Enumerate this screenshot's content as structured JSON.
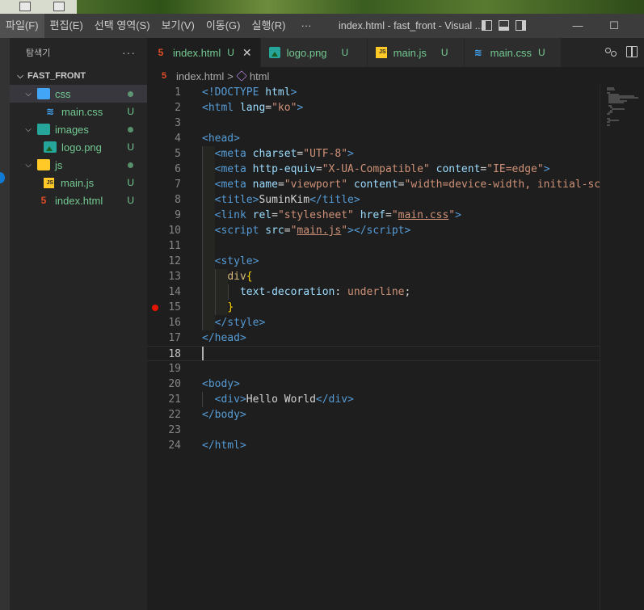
{
  "menubar": {
    "items": [
      "파일(F)",
      "편집(E)",
      "선택 영역(S)",
      "보기(V)",
      "이동(G)",
      "실행(R)",
      "···"
    ],
    "window_title": "index.html - fast_front - Visual ...",
    "restore_glyph": "☐",
    "minimize_glyph": "—"
  },
  "sidebar": {
    "title": "탐색기",
    "more": "···",
    "project": "FAST_FRONT",
    "tree": [
      {
        "label": "css",
        "type": "folder",
        "icon": "folder-css-icon",
        "status": "dot",
        "depth": 0
      },
      {
        "label": "main.css",
        "type": "css",
        "icon": "css-file-icon",
        "status": "U",
        "depth": 1
      },
      {
        "label": "images",
        "type": "folder",
        "icon": "folder-images-icon",
        "status": "dot",
        "depth": 0
      },
      {
        "label": "logo.png",
        "type": "image",
        "icon": "image-file-icon",
        "status": "U",
        "depth": 1
      },
      {
        "label": "js",
        "type": "folder",
        "icon": "folder-js-icon",
        "status": "dot",
        "depth": 0
      },
      {
        "label": "main.js",
        "type": "js",
        "icon": "js-file-icon",
        "status": "U",
        "depth": 1
      },
      {
        "label": "index.html",
        "type": "html",
        "icon": "html-file-icon",
        "status": "U",
        "depth": 0
      }
    ]
  },
  "tabs": [
    {
      "label": "index.html",
      "status": "U",
      "icon": "html-file-icon",
      "active": true,
      "close": "✕"
    },
    {
      "label": "logo.png",
      "status": "U",
      "icon": "image-file-icon",
      "active": false
    },
    {
      "label": "main.js",
      "status": "U",
      "icon": "js-file-icon",
      "active": false
    },
    {
      "label": "main.css",
      "status": "U",
      "icon": "css-file-icon",
      "active": false
    }
  ],
  "breadcrumb": {
    "file": "index.html",
    "separator": ">",
    "symbol": "html"
  },
  "editor": {
    "current_line": 18,
    "breakpoint_line": 15,
    "lines": [
      {
        "n": "1",
        "html": "<span class='t-tag'>&lt;!DOCTYPE</span> <span class='t-attr'>html</span><span class='t-tag'>&gt;</span>"
      },
      {
        "n": "2",
        "html": "<span class='t-tag'>&lt;html</span> <span class='t-attr'>lang</span><span class='t-text'>=</span><span class='t-str'>\"ko\"</span><span class='t-tag'>&gt;</span>"
      },
      {
        "n": "3",
        "html": ""
      },
      {
        "n": "4",
        "html": "<span class='t-tag'>&lt;head&gt;</span>"
      },
      {
        "n": "5",
        "html": "  <span class='t-tag'>&lt;meta</span> <span class='t-attr'>charset</span><span class='t-text'>=</span><span class='t-str'>\"UTF-8\"</span><span class='t-tag'>&gt;</span>"
      },
      {
        "n": "6",
        "html": "  <span class='t-tag'>&lt;meta</span> <span class='t-attr'>http-equiv</span><span class='t-text'>=</span><span class='t-str'>\"X-UA-Compatible\"</span> <span class='t-attr'>content</span><span class='t-text'>=</span><span class='t-str'>\"IE=edge\"</span><span class='t-tag'>&gt;</span>"
      },
      {
        "n": "7",
        "html": "  <span class='t-tag'>&lt;meta</span> <span class='t-attr'>name</span><span class='t-text'>=</span><span class='t-str'>\"viewport\"</span> <span class='t-attr'>content</span><span class='t-text'>=</span><span class='t-str'>\"width=device-width, initial-sca</span>"
      },
      {
        "n": "8",
        "html": "  <span class='t-tag'>&lt;title&gt;</span><span class='t-text'>SuminKim</span><span class='t-tag'>&lt;/title&gt;</span>"
      },
      {
        "n": "9",
        "html": "  <span class='t-tag'>&lt;link</span> <span class='t-attr'>rel</span><span class='t-text'>=</span><span class='t-str'>\"stylesheet\"</span> <span class='t-attr'>href</span><span class='t-text'>=</span><span class='t-str'>\"<span class='t-ul'>main.css</span>\"</span><span class='t-tag'>&gt;</span>"
      },
      {
        "n": "10",
        "html": "  <span class='t-tag'>&lt;script</span> <span class='t-attr'>src</span><span class='t-text'>=</span><span class='t-str'>\"<span class='t-ul'>main.js</span>\"</span><span class='t-tag'>&gt;&lt;/script&gt;</span>"
      },
      {
        "n": "11",
        "html": ""
      },
      {
        "n": "12",
        "html": "  <span class='t-tag'>&lt;style&gt;</span>"
      },
      {
        "n": "13",
        "html": "    <span class='t-sel'>div</span><span class='t-brace'>{</span>"
      },
      {
        "n": "14",
        "html": "      <span class='t-prop'>text-decoration</span><span class='t-text'>: </span><span class='t-val'>underline</span><span class='t-text'>;</span>"
      },
      {
        "n": "15",
        "html": "    <span class='t-brace'>}</span>"
      },
      {
        "n": "16",
        "html": "  <span class='t-tag'>&lt;/style&gt;</span>"
      },
      {
        "n": "17",
        "html": "<span class='t-tag'>&lt;/head&gt;</span>"
      },
      {
        "n": "18",
        "html": ""
      },
      {
        "n": "19",
        "html": ""
      },
      {
        "n": "20",
        "html": "<span class='t-tag'>&lt;body&gt;</span>"
      },
      {
        "n": "21",
        "html": "  <span class='t-tag'>&lt;div&gt;</span><span class='t-text'>Hello World</span><span class='t-tag'>&lt;/div&gt;</span>"
      },
      {
        "n": "22",
        "html": "<span class='t-tag'>&lt;/body&gt;</span>"
      },
      {
        "n": "23",
        "html": ""
      },
      {
        "n": "24",
        "html": "<span class='t-tag'>&lt;/html&gt;</span>"
      }
    ]
  },
  "colors": {
    "accent_untracked": "#73c991",
    "tag": "#569cd6",
    "attribute": "#9cdcfe",
    "string": "#ce9178",
    "breakpoint": "#e51400"
  }
}
